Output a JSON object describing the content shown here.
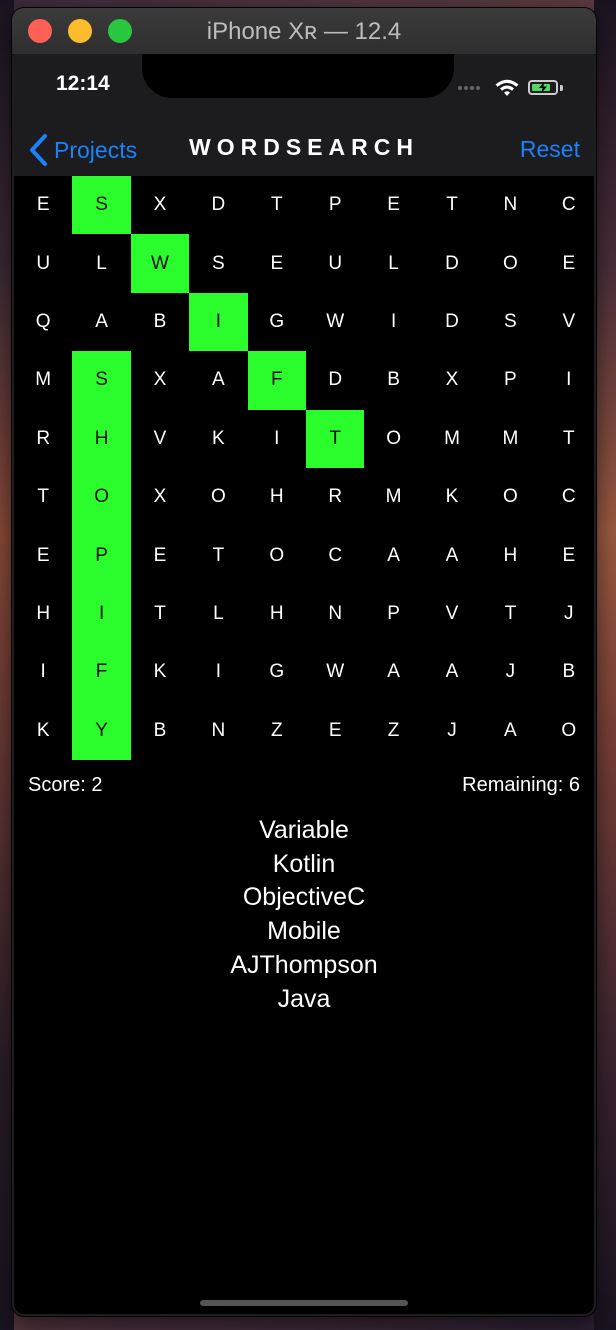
{
  "window": {
    "title": "iPhone Xʀ — 12.4"
  },
  "status_bar": {
    "time": "12:14",
    "battery_charging": true
  },
  "nav": {
    "back_label": "Projects",
    "title": "WORDSEARCH",
    "reset_label": "Reset"
  },
  "grid": {
    "rows": [
      [
        "E",
        "S",
        "X",
        "D",
        "T",
        "P",
        "E",
        "T",
        "N",
        "C"
      ],
      [
        "U",
        "L",
        "W",
        "S",
        "E",
        "U",
        "L",
        "D",
        "O",
        "E"
      ],
      [
        "Q",
        "A",
        "B",
        "I",
        "G",
        "W",
        "I",
        "D",
        "S",
        "V"
      ],
      [
        "M",
        "S",
        "X",
        "A",
        "F",
        "D",
        "B",
        "X",
        "P",
        "I"
      ],
      [
        "R",
        "H",
        "V",
        "K",
        "I",
        "T",
        "O",
        "M",
        "M",
        "T"
      ],
      [
        "T",
        "O",
        "X",
        "O",
        "H",
        "R",
        "M",
        "K",
        "O",
        "C"
      ],
      [
        "E",
        "P",
        "E",
        "T",
        "O",
        "C",
        "A",
        "A",
        "H",
        "E"
      ],
      [
        "H",
        "I",
        "T",
        "L",
        "H",
        "N",
        "P",
        "V",
        "T",
        "J"
      ],
      [
        "I",
        "F",
        "K",
        "I",
        "G",
        "W",
        "A",
        "A",
        "J",
        "B"
      ],
      [
        "K",
        "Y",
        "B",
        "N",
        "Z",
        "E",
        "Z",
        "J",
        "A",
        "O"
      ]
    ],
    "found_words": [
      "SWIFT",
      "SHOPIFY"
    ],
    "highlight_color": "#2bfc2b"
  },
  "score": {
    "label": "Score: 2",
    "remaining_label": "Remaining: 6"
  },
  "words": [
    "Variable",
    "Kotlin",
    "ObjectiveC",
    "Mobile",
    "AJThompson",
    "Java"
  ],
  "colors": {
    "accent": "#1a82fb",
    "background": "#000000",
    "navbar": "#1c1c1e"
  }
}
